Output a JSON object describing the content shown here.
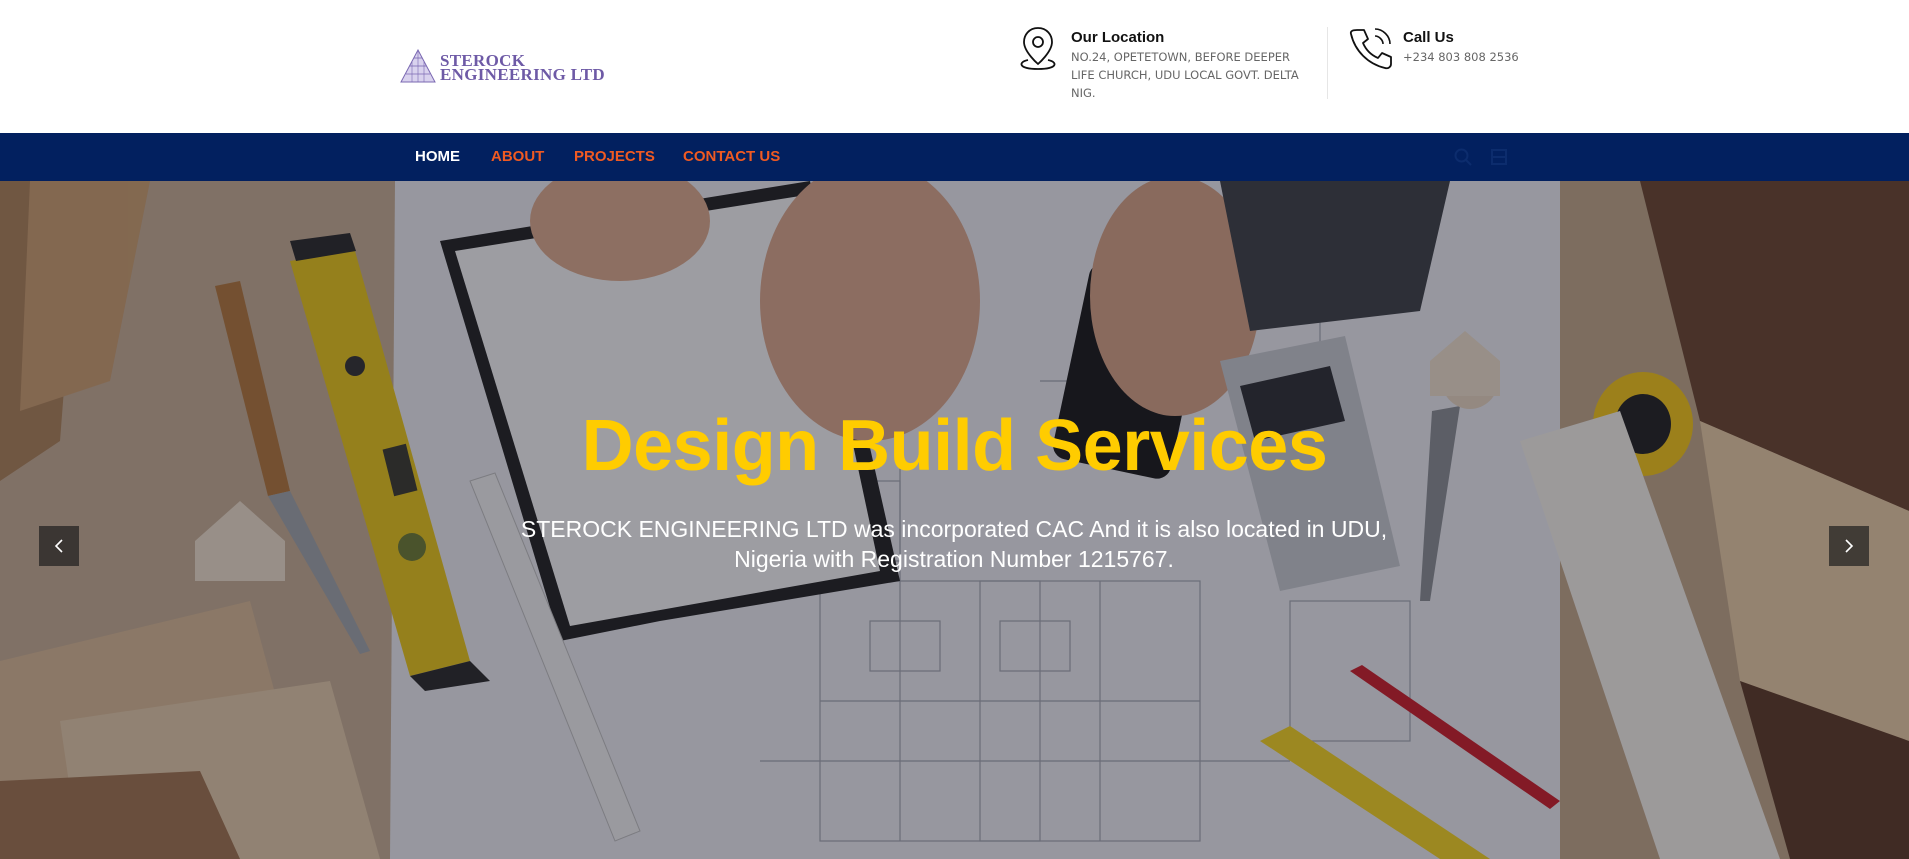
{
  "logo": {
    "line1": "STEROCK",
    "line2": "ENGINEERING LTD"
  },
  "location": {
    "title": "Our Location",
    "address": "NO.24, OPETETOWN, BEFORE DEEPER LIFE CHURCH, UDU LOCAL GOVT. DELTA NIG.",
    "icon": "map-pin-icon"
  },
  "call": {
    "title": "Call Us",
    "phone": "+234 803 808 2536",
    "icon": "phone-icon"
  },
  "nav": {
    "items": [
      {
        "label": "HOME",
        "active": true
      },
      {
        "label": "ABOUT",
        "active": false
      },
      {
        "label": "PROJECTS",
        "active": false
      },
      {
        "label": "CONTACT US",
        "active": false
      }
    ],
    "icons": [
      "search-icon",
      "menu-icon"
    ]
  },
  "hero": {
    "title": "Design Build Services",
    "text": "STEROCK ENGINEERING LTD was incorporated CAC And it is also located in UDU, Nigeria with Registration Number 1215767.",
    "prev_icon": "chevron-left-icon",
    "next_icon": "chevron-right-icon"
  },
  "colors": {
    "nav_bg": "#02205f",
    "nav_link": "#f05a22",
    "nav_active": "#ffffff",
    "hero_title": "#ffcc00",
    "logo": "#6e5aa6"
  }
}
